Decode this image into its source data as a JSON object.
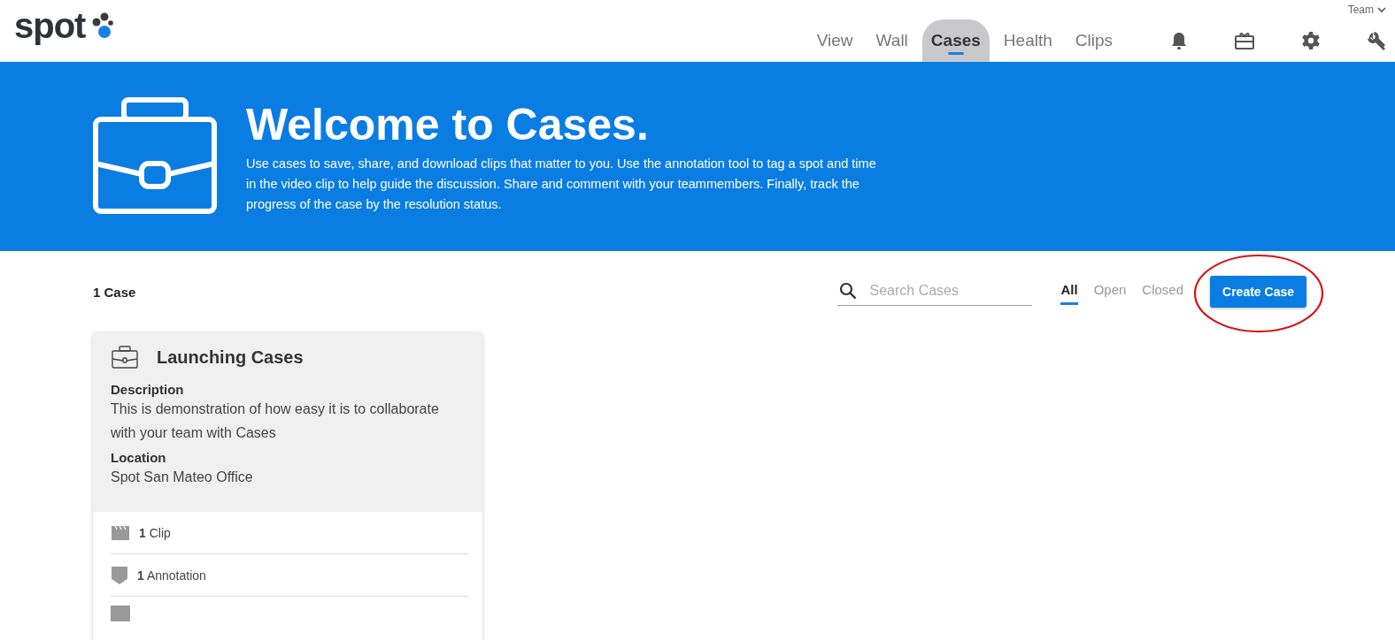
{
  "header": {
    "logo": "spot",
    "team_menu": "Team",
    "nav": [
      {
        "label": "View",
        "selected": false
      },
      {
        "label": "Wall",
        "selected": false
      },
      {
        "label": "Cases",
        "selected": true
      },
      {
        "label": "Health",
        "selected": false
      },
      {
        "label": "Clips",
        "selected": false
      }
    ],
    "tools": [
      {
        "kind": "bell"
      },
      {
        "kind": "gift"
      },
      {
        "kind": "gear"
      },
      {
        "kind": "wrench"
      }
    ]
  },
  "banner": {
    "title": "Welcome to Cases.",
    "text": "Use cases to save, share, and download clips that matter to you. Use the annotation tool to tag a spot and time in the video clip to help guide the discussion. Share and comment with your teammembers. Finally, track the progress of the case by the resolution status."
  },
  "toolbar": {
    "count": "1 Case",
    "search": {
      "placeholder": "Search Cases"
    },
    "filters": [
      {
        "label": "All",
        "selected": true
      },
      {
        "label": "Open",
        "selected": false
      },
      {
        "label": "Closed",
        "selected": false
      }
    ],
    "create_button": "Create Case"
  },
  "cases": [
    {
      "title": "Launching Cases",
      "description_label": "Description",
      "description": "This is demonstration of how easy it is to collaborate with your team with Cases",
      "location_label": "Location",
      "location": "Spot San Mateo Office",
      "stats": [
        {
          "kind": "clip",
          "count": "1",
          "label": "Clip"
        },
        {
          "kind": "annotation",
          "count": "1",
          "label": "Annotation"
        }
      ]
    }
  ]
}
